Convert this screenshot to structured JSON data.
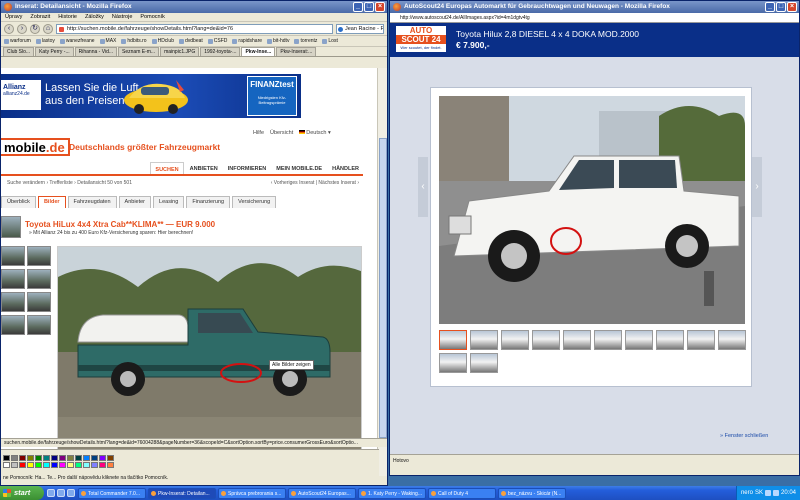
{
  "left_window": {
    "title": "Inserat: Detailansicht - Mozilla Firefox",
    "menu": [
      "Úpravy",
      "Zobrazit",
      "Historie",
      "Záložky",
      "Nástroje",
      "Pomocník"
    ],
    "url": "http://suchen.mobile.de/fahrzeuge/showDetails.html?lang=de&id=76",
    "search_placeholder": "Jean Racine - FAIO",
    "bookmarks": [
      "warforum",
      "lastoy",
      "wanezfreane",
      "MAX",
      "hdbits.ro",
      "HDclub",
      "dvdbeat",
      "CSFD",
      "rapidshare",
      "bit-hdtv",
      "torrentz",
      "Lost"
    ],
    "tabs": [
      "Club Slo...",
      "Katy Perry -...",
      "Rihanna - Vid...",
      "Seznam E-m...",
      "mainpic1.JPG",
      "1992-toyota-...",
      "Pkw-Inse...",
      "Pkw-Inserat:..."
    ],
    "status": "suchen.mobile.de/fahrzeuge/showDetails.html?lang=de&id=76004288&pageNumber=36&scopeId=C&sortOption.sortBy=price.consumerGrossEuro&sortOptio...",
    "banner": {
      "brand": "Allianz",
      "brand_sub": "allianz24.de",
      "text1": "Lassen Sie die Luft",
      "text2": "aus den Preisen!",
      "badge": "FINANZtest",
      "badge_sub": "Niedrigsten Kfz-Beitragsprämie"
    },
    "site": {
      "logo_prefix": "mobile",
      "logo_suffix": ".de",
      "slogan": "Deutschlands größter Fahrzeugmarkt",
      "hilfe": "Hilfe",
      "uebersicht": "Übersicht",
      "lang": "Deutsch"
    },
    "nav": [
      "SUCHEN",
      "ANBIETEN",
      "INFORMIEREN",
      "MEIN MOBILE.DE",
      "HÄNDLER"
    ],
    "breadcrumb": "Suche verändern  ›  Trefferliste  ›  Detailansicht 50 von 501",
    "prevnext": "‹ Vorheriges Inserat  |  Nächstes Inserat ›",
    "detail_tabs": [
      "Überblick",
      "Bilder",
      "Fahrzeugdaten",
      "Anbieter",
      "Leasing",
      "Finanzierung",
      "Versicherung"
    ],
    "car_title": "Toyota HiLux 4x4 Xtra Cab**KLIMA** — EUR 9.000",
    "car_sub": "» Mit Allianz 24 bis zu 400 Euro Kfz-Versicherung sparen: Hier berechnen!",
    "all_pics": "Alle Bilder zeigen",
    "bottom_status": "ne Pomocník: Ha... Te... Pro další nápovědu kliknete na tlačítko Pomocník."
  },
  "right_window": {
    "title": "AutoScout24 Europas Automarkt für Gebrauchtwagen und Neuwagen - Mozilla Firefox",
    "url": "http://www.autoscout24.de/AllImages.aspx?id=4m1dgtv4tg",
    "logo_top": "AUTO",
    "logo_mid": "SCOUT 24",
    "logo_bot": "Wer scoutet, der findet.",
    "car_title": "Toyota Hilux 2,8 DIESEL 4 x 4 DOKA MOD.2000",
    "price": "€ 7.900,-",
    "close_link": "» Fenster schließen",
    "status": "Hotovo"
  },
  "taskbar": {
    "start": "start",
    "tasks": [
      "Total Commander 7.0...",
      "Pkw-Inserat: Detailan...",
      "Správca prebrorania s...",
      "AutoScout24 Europas...",
      "1. Katy Perry - Waking...",
      "Call of Duty 4",
      "bez_názvu - Skicár (N..."
    ],
    "lang": "SK",
    "clock": "20:04",
    "tray_label": "nero"
  }
}
